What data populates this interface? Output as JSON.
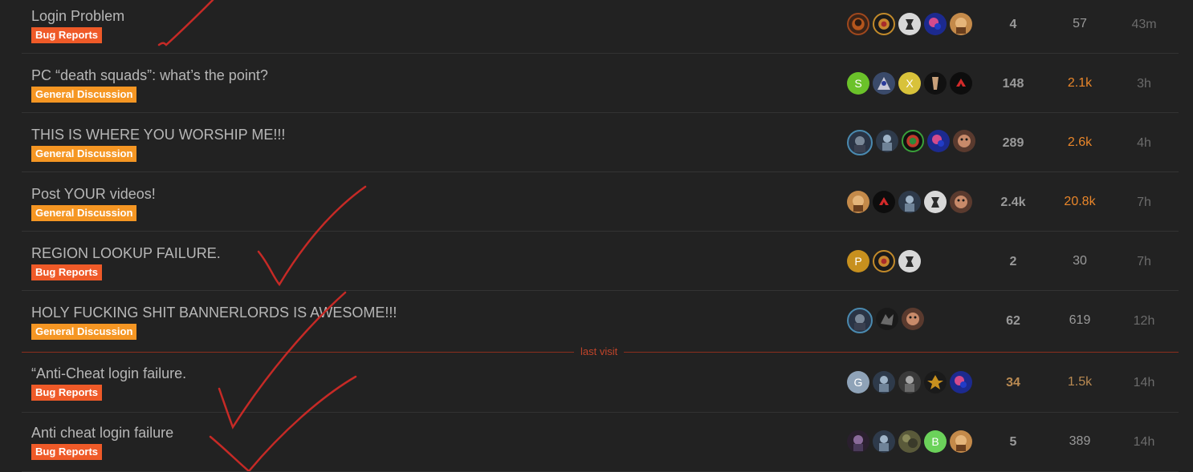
{
  "topics": [
    {
      "title": "Login Problem",
      "category": "Bug Reports",
      "avatars": [
        "fire-avatar",
        "emblem-avatar",
        "white-figure-avatar",
        "blue-orb-avatar",
        "face-avatar"
      ],
      "replies": "4",
      "views": "57",
      "activity": "43m"
    },
    {
      "title": "PC “death squads”: what’s the point?",
      "category": "General Discussion",
      "avatars": [
        "letter-s-avatar",
        "knight-avatar",
        "letter-x-avatar",
        "dark-figure-avatar",
        "red-symbol-avatar"
      ],
      "avatar_letters": [
        "S",
        "",
        "X",
        "",
        ""
      ],
      "replies": "148",
      "views": "2.1k",
      "activity": "3h"
    },
    {
      "title": "THIS IS WHERE YOU WORSHIP ME!!!",
      "category": "General Discussion",
      "avatars": [
        "warrior-avatar",
        "armored-figure-avatar",
        "green-target-avatar",
        "blue-orb-avatar",
        "face-avatar"
      ],
      "replies": "289",
      "views": "2.6k",
      "activity": "4h"
    },
    {
      "title": "Post YOUR videos!",
      "category": "General Discussion",
      "avatars": [
        "face-avatar",
        "red-symbol-avatar",
        "armored-figure-avatar",
        "white-figure-avatar",
        "face-avatar"
      ],
      "replies": "2.4k",
      "views": "20.8k",
      "activity": "7h"
    },
    {
      "title": "REGION LOOKUP FAILURE.",
      "category": "Bug Reports",
      "avatars": [
        "letter-p-avatar",
        "emblem-avatar",
        "white-figure-avatar"
      ],
      "avatar_letters": [
        "P",
        "",
        ""
      ],
      "replies": "2",
      "views": "30",
      "activity": "7h"
    },
    {
      "title": "HOLY FUCKING SHIT BANNERLORDS IS AWESOME!!!",
      "category": "General Discussion",
      "avatars": [
        "warrior-avatar",
        "dark-figure-avatar",
        "face-avatar"
      ],
      "replies": "62",
      "views": "619",
      "activity": "12h"
    },
    {
      "title": "“Anti-Cheat login failure.",
      "category": "Bug Reports",
      "avatars": [
        "letter-g-avatar",
        "armored-figure-avatar",
        "armored-figure-avatar",
        "gold-figure-avatar",
        "blue-orb-avatar"
      ],
      "avatar_letters": [
        "G",
        "",
        "",
        "",
        ""
      ],
      "replies": "34",
      "views": "1.5k",
      "activity": "14h"
    },
    {
      "title": "Anti cheat login failure",
      "category": "Bug Reports",
      "avatars": [
        "purple-figure-avatar",
        "armored-figure-avatar",
        "camo-avatar",
        "letter-b-avatar",
        "face-avatar"
      ],
      "avatar_letters": [
        "",
        "",
        "",
        "B",
        ""
      ],
      "replies": "5",
      "views": "389",
      "activity": "14h"
    }
  ],
  "last_visit_label": "last visit",
  "colors": {
    "bug_reports": "#ef5a28",
    "general_discussion": "#f59623",
    "hot_views": "#e9862a",
    "warm_views": "#b98a52",
    "replies_hot": "#b98a52",
    "divider": "#8b2e1d",
    "scribble": "#c62a26"
  }
}
